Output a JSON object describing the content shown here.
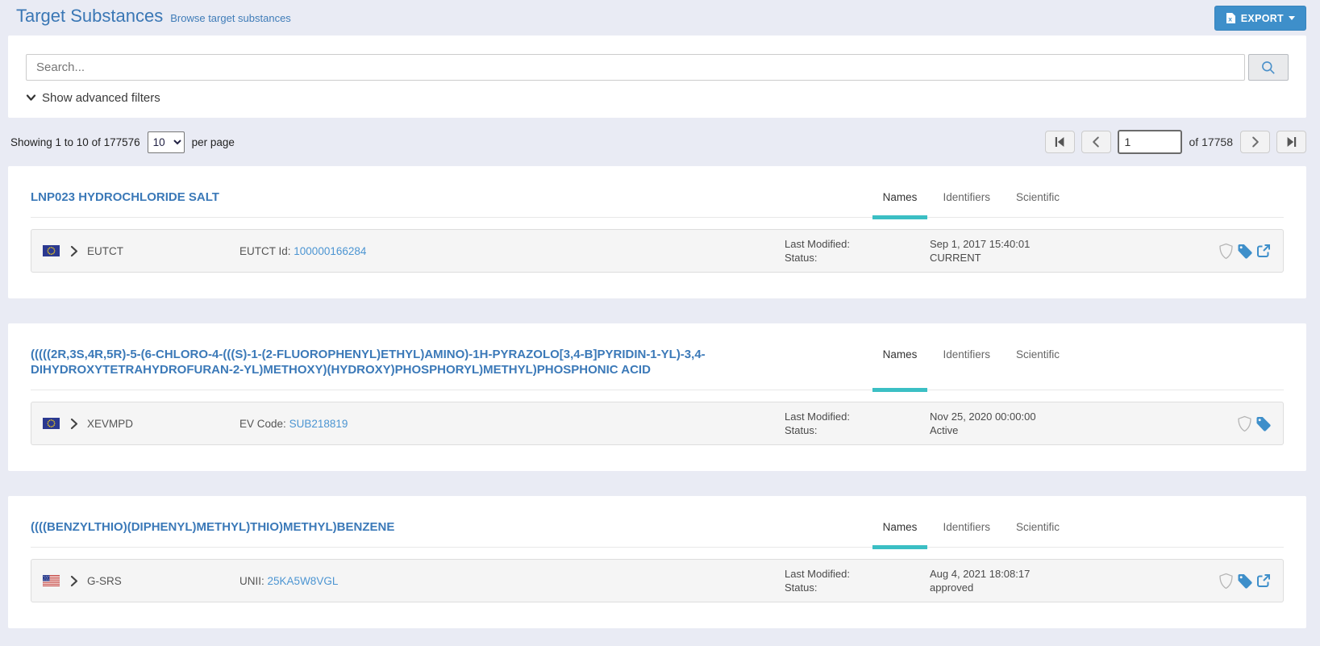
{
  "page": {
    "title": "Target Substances",
    "subtitle": "Browse target substances",
    "export_label": "EXPORT"
  },
  "search": {
    "placeholder": "Search...",
    "advanced_filters_label": "Show advanced filters"
  },
  "pagination": {
    "showing_text": "Showing 1 to 10 of 177576",
    "per_page_value": "10",
    "per_page_label": "per page",
    "page_value": "1",
    "of_label": "of 17758"
  },
  "row_labels": {
    "last_modified": "Last Modified:",
    "status": "Status:"
  },
  "substances": [
    {
      "name": "LNP023 HYDROCHLORIDE SALT",
      "tabs": [
        "Names",
        "Identifiers",
        "Scientific"
      ],
      "active_tab": "Names",
      "row": {
        "flag": "eu-flag",
        "source": "EUTCT",
        "code_label": "EUTCT Id:",
        "code_value": "100000166284",
        "last_modified": "Sep 1, 2017 15:40:01",
        "status": "CURRENT",
        "icons": [
          "shield",
          "tag",
          "external-link"
        ]
      }
    },
    {
      "name": "(((((2R,3S,4R,5R)-5-(6-CHLORO-4-(((S)-1-(2-FLUOROPHENYL)ETHYL)AMINO)-1H-PYRAZOLO[3,4-B]PYRIDIN-1-YL)-3,4-DIHYDROXYTETRAHYDROFURAN-2-YL)METHOXY)(HYDROXY)PHOSPHORYL)METHYL)PHOSPHONIC ACID",
      "tabs": [
        "Names",
        "Identifiers",
        "Scientific"
      ],
      "active_tab": "Names",
      "row": {
        "flag": "eu-flag",
        "source": "XEVMPD",
        "code_label": "EV Code:",
        "code_value": "SUB218819",
        "last_modified": "Nov 25, 2020 00:00:00",
        "status": "Active",
        "icons": [
          "shield",
          "tag"
        ]
      }
    },
    {
      "name": "((((BENZYLTHIO)(DIPHENYL)METHYL)THIO)METHYL)BENZENE",
      "tabs": [
        "Names",
        "Identifiers",
        "Scientific"
      ],
      "active_tab": "Names",
      "row": {
        "flag": "us-flag",
        "source": "G-SRS",
        "code_label": "UNII:",
        "code_value": "25KA5W8VGL",
        "last_modified": "Aug 4, 2021 18:08:17",
        "status": "approved",
        "icons": [
          "shield",
          "tag",
          "external-link"
        ]
      }
    }
  ],
  "colors": {
    "accent_blue": "#3e8fca",
    "link_blue": "#4c95d2",
    "title_blue": "#3b79b8",
    "tab_active_teal": "#3bbfc4",
    "page_background": "#e9ebf4"
  }
}
